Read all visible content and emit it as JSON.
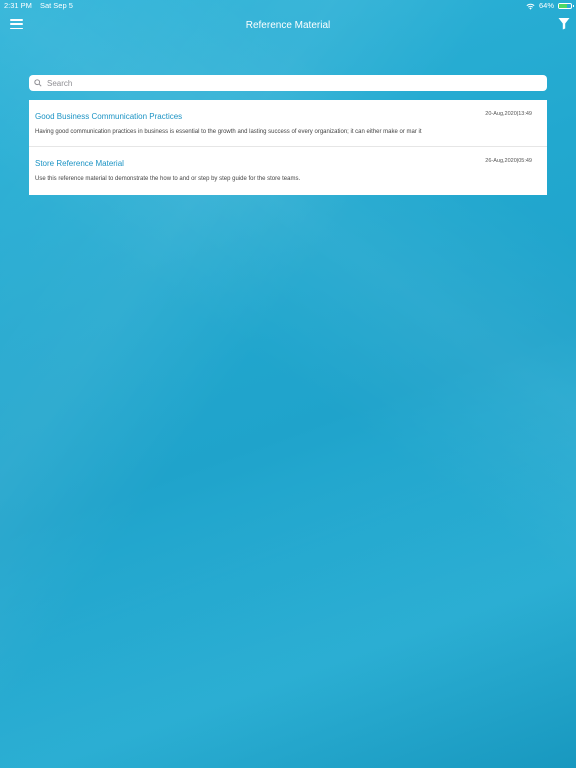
{
  "status_bar": {
    "time": "2:31 PM",
    "date": "Sat Sep 5",
    "battery": "64%",
    "battery_level": 0.64,
    "icons": [
      "wifi-icon",
      "battery-icon"
    ]
  },
  "nav": {
    "title": "Reference Material",
    "left_icon": "menu-icon",
    "right_icon": "filter-icon"
  },
  "search": {
    "placeholder": "Search",
    "value": "",
    "icon": "search-icon"
  },
  "items": [
    {
      "title": "Good Business Communication Practices",
      "date": "20-Aug,2020|13:49",
      "description": "Having good communication practices in business is essential to the growth and lasting success of every organization; it can either make or mar it"
    },
    {
      "title": "Store Reference Material",
      "date": "26-Aug,2020|05:49",
      "description": "Use this reference material to demonstrate the how to and or step by step guide for the store teams."
    }
  ],
  "colors": {
    "background": "#22a8cf",
    "accent": "#1b93c4",
    "card": "#ffffff"
  }
}
